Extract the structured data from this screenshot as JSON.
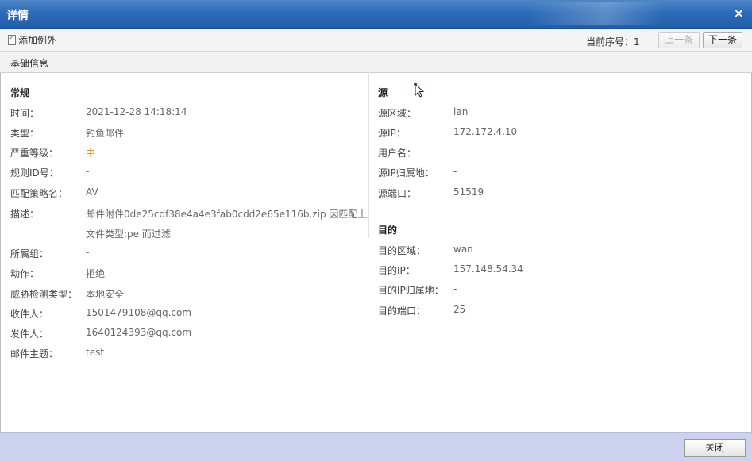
{
  "window": {
    "title": "详情",
    "close_glyph": "×"
  },
  "toolbar": {
    "add_exception_label": "添加例外",
    "current_seq_label": "当前序号：1",
    "prev_button": "上一条",
    "next_button": "下一条"
  },
  "tab": {
    "label": "基础信息"
  },
  "general": {
    "title": "常规",
    "rows": [
      {
        "label": "时间：",
        "value": "2021-12-28 14:18:14"
      },
      {
        "label": "类型：",
        "value": "钓鱼邮件"
      },
      {
        "label": "严重等级：",
        "value": "中",
        "color": "#e08a00"
      },
      {
        "label": "规则ID号：",
        "value": "-"
      },
      {
        "label": "匹配策略名：",
        "value": "AV"
      },
      {
        "label": "描述：",
        "value": "邮件附件0de25cdf38e4a4e3fab0cdd2e65e116b.zip 因匹配上",
        "value2": "文件类型:pe 而过滤"
      },
      {
        "label": "所属组：",
        "value": "-"
      },
      {
        "label": "动作：",
        "value": "拒绝"
      },
      {
        "label": "威胁检测类型：",
        "value": "本地安全"
      },
      {
        "label": "收件人：",
        "value": "1501479108@qq.com"
      },
      {
        "label": "发件人：",
        "value": "1640124393@qq.com"
      },
      {
        "label": "邮件主题：",
        "value": "test"
      }
    ]
  },
  "source": {
    "title": "源",
    "rows": [
      {
        "label": "源区域：",
        "value": "lan"
      },
      {
        "label": "源IP：",
        "value": "172.172.4.10"
      },
      {
        "label": "用户名：",
        "value": "-"
      },
      {
        "label": "源IP归属地：",
        "value": "-"
      },
      {
        "label": "源端口：",
        "value": "51519"
      }
    ]
  },
  "destination": {
    "title": "目的",
    "rows": [
      {
        "label": "目的区域：",
        "value": "wan"
      },
      {
        "label": "目的IP：",
        "value": "157.148.54.34"
      },
      {
        "label": "目的IP归属地：",
        "value": "-"
      },
      {
        "label": "目的端口：",
        "value": "25"
      }
    ]
  },
  "footer": {
    "close_button": "关闭"
  }
}
